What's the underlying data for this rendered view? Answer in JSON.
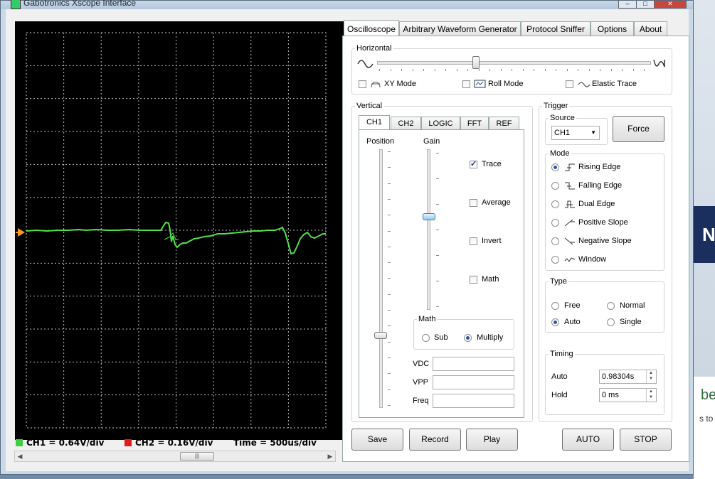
{
  "window": {
    "title": "Gabotronics Xscope Interface"
  },
  "main_tabs": [
    "Oscilloscope",
    "Arbitrary Waveform Generator",
    "Protocol Sniffer",
    "Options",
    "About"
  ],
  "horizontal": {
    "label": "Horizontal",
    "xy_mode": "XY Mode",
    "roll_mode": "Roll Mode",
    "elastic_trace": "Elastic Trace",
    "slider_position": 0.36
  },
  "vertical": {
    "label": "Vertical",
    "tabs": [
      "CH1",
      "CH2",
      "LOGIC",
      "FFT",
      "REF"
    ],
    "position_label": "Position",
    "gain_label": "Gain",
    "position_value": 0.72,
    "gain_value": 0.42,
    "trace": "Trace",
    "average": "Average",
    "invert": "Invert",
    "math": "Math",
    "math_group": "Math",
    "sub": "Sub",
    "multiply": "Multiply",
    "vdc": "VDC",
    "vpp": "VPP",
    "freq": "Freq"
  },
  "trigger": {
    "label": "Trigger",
    "source_label": "Source",
    "source_value": "CH1",
    "force": "Force",
    "mode_label": "Mode",
    "modes": [
      "Rising Edge",
      "Falling Edge",
      "Dual Edge",
      "Positive Slope",
      "Negative Slope",
      "Window"
    ],
    "type_label": "Type",
    "free": "Free",
    "normal": "Normal",
    "auto": "Auto",
    "single": "Single",
    "timing_label": "Timing",
    "auto_timing_label": "Auto",
    "auto_value": "0.98304s",
    "hold_label": "Hold",
    "hold_value": "0 ms"
  },
  "buttons": {
    "save": "Save",
    "record": "Record",
    "play": "Play",
    "auto": "AUTO",
    "stop": "STOP"
  },
  "status": {
    "ch1": "CH1 = 0.64V/div",
    "ch2": "CH2 = 0.16V/div",
    "time": "Time = 500us/div"
  },
  "colors": {
    "ch1": "#3ecf3e",
    "ch2": "#e31919",
    "trace": "#52e04a"
  },
  "desktop": {
    "n_letter": "N",
    "be_text": "be",
    "s_to": "s to"
  }
}
